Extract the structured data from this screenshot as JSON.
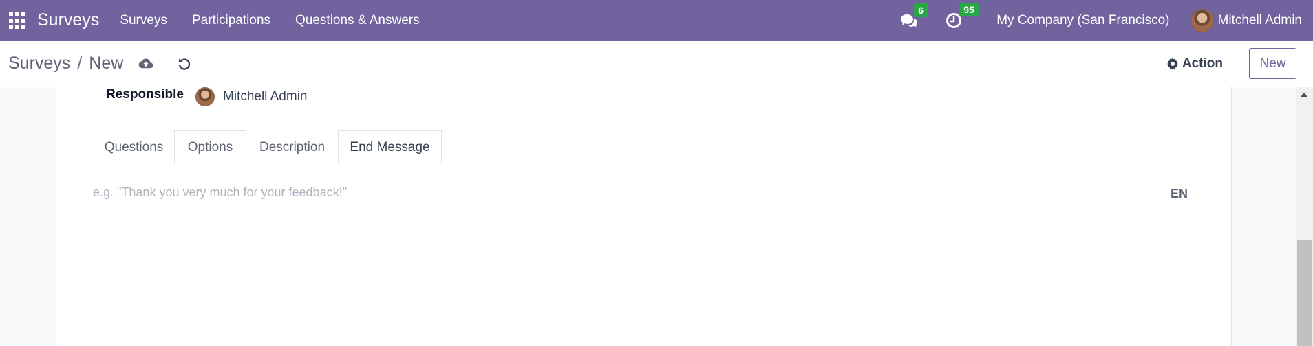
{
  "navbar": {
    "brand": "Surveys",
    "menu": [
      "Surveys",
      "Participations",
      "Questions & Answers"
    ],
    "messages_count": "6",
    "activities_count": "95",
    "company": "My Company (San Francisco)",
    "user": "Mitchell Admin"
  },
  "control_panel": {
    "breadcrumb_parent": "Surveys",
    "breadcrumb_separator": "/",
    "breadcrumb_current": "New",
    "action_label": "Action",
    "new_label": "New"
  },
  "form": {
    "responsible_label": "Responsible",
    "responsible_value": "Mitchell Admin",
    "tabs": [
      "Questions",
      "Options",
      "Description",
      "End Message"
    ],
    "active_tab": "End Message",
    "end_message_placeholder": "e.g. \"Thank you very much for your feedback!\"",
    "lang_label": "EN"
  },
  "colors": {
    "navbar_bg": "#71639e",
    "badge_bg": "#28a745"
  },
  "icons": [
    "apps-grid-icon",
    "chat-icon",
    "clock-icon",
    "cloud-upload-icon",
    "undo-icon",
    "gear-icon"
  ]
}
